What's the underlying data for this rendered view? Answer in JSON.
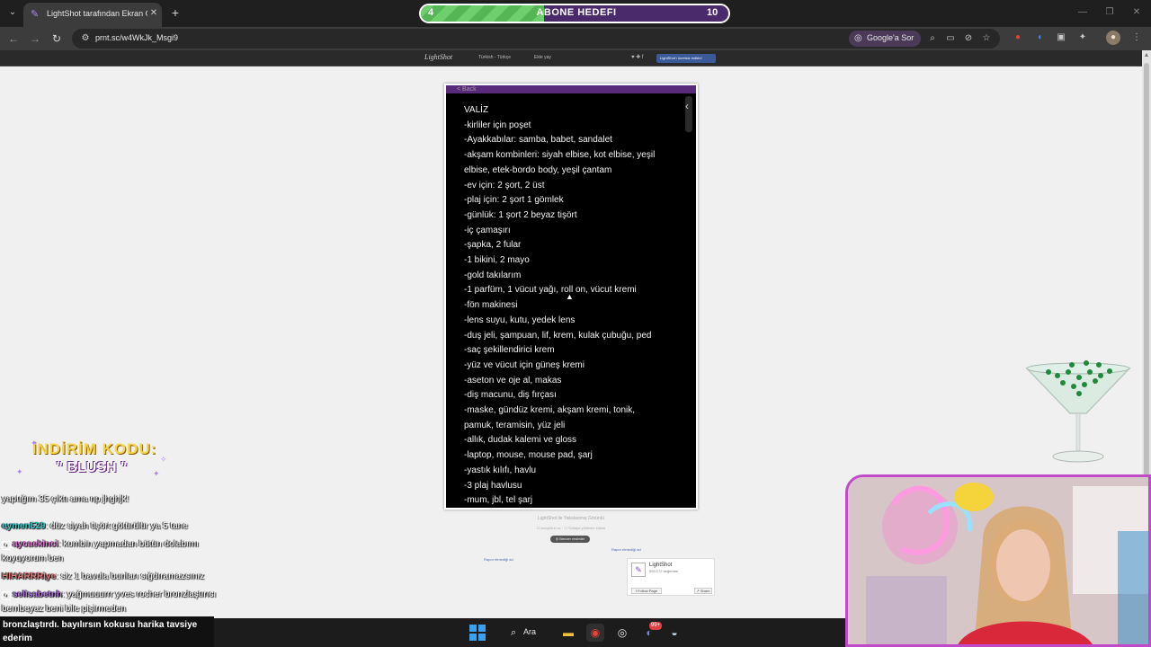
{
  "browser": {
    "tab_title": "LightShot tarafından Ekran Görü",
    "url": "prnt.sc/w4WkJk_Msgi9",
    "google_lens_label": "Google'a Sor"
  },
  "subscriber_goal": {
    "label": "ABONE HEDEFI",
    "current": "4",
    "target": "10",
    "progress": 0.4
  },
  "lightshot_header": {
    "logo": "LightShot",
    "language": "Türkish - Türkçe",
    "share": "Ekle yay",
    "social": "♥ ✚ f",
    "download": "LightShot'ı ücretsiz indirin!"
  },
  "note": {
    "back": "< Back",
    "lines": [
      "VALİZ",
      "-kirliler için poşet",
      "-Ayakkabılar: samba, babet, sandalet",
      "-akşam kombinleri: siyah elbise, kot elbise, yeşil",
      "elbise, etek-bordo body, yeşil çantam",
      "-ev için: 2 şort, 2 üst",
      "-plaj için: 2 şort 1 gömlek",
      "-günlük: 1 şort 2 beyaz tişört",
      "-iç çamaşırı",
      "-şapka, 2 fular",
      "-1 bikini, 2 mayo",
      "-gold takılarım",
      "-1 parfüm, 1 vücut yağı, roll on, vücut kremi",
      "-fön makinesi",
      "-lens suyu, kutu, yedek lens",
      "-duş jeli, şampuan, lif, krem, kulak çubuğu, ped",
      "-saç şekillendirici krem",
      "-yüz ve vücut için güneş kremi",
      "-aseton ve oje al, makas",
      "-diş macunu, diş fırçası",
      "-maske, gündüz kremi, akşam kremi, tonik,",
      "pamuk, teramisin, yüz jeli",
      "-allık, dudak kalemi ve gloss",
      "-laptop, mouse, mouse pad, şarj",
      "-yastık kılıfı, havlu",
      "-3 plaj havlusu",
      "-mum, jbl, tel şarj"
    ]
  },
  "below_screenshot": {
    "caption": "LightShot ile Yakalanmış Görüntü",
    "links": "☐ sampleurl.sc · ☐ Soltaya yükleme süresi",
    "similar_button": "◎ Benzer resimler",
    "report_left": "Rapor etmediği ad",
    "report_right": "Rapor etmediği ad"
  },
  "facebook_box": {
    "name": "LightShot",
    "followers": "590.172 beğenme",
    "follow": "f Follow Page",
    "share": "↗ Share"
  },
  "promo": {
    "label": "İNDİRİM KODU:",
    "code": "\" BLUSH \""
  },
  "chat": [
    {
      "user": "",
      "text": "yaptığım 35 çıktı ama np jhghjk!",
      "color": "#ffffff",
      "badge": ""
    },
    {
      "user": "eymen529",
      "text": ": düz siyah tişört götürülür ya 5 tane",
      "color": "#3ac7c7",
      "badge": ""
    },
    {
      "user": "aycaekinci",
      "text": ": kombin yapmadan bütün dolabımı koyuyorum ben",
      "color": "#e07ad8",
      "badge": "◐"
    },
    {
      "user": "HIHARRRiye",
      "text": ": siz 1 bavula bunları sığdıramazsınız",
      "color": "#e07a7a",
      "badge": ""
    },
    {
      "user": "selisabetnh",
      "text": ": yağmuuurrr yves rocher bronzlaştırıcı bembeyaz beni bile pişirmeden",
      "color": "#b07ae0",
      "badge": "◐"
    }
  ],
  "stream_caption": "bronzlaştırdı. bayılırsın kokusu harika tavsiye ederim",
  "taskbar": {
    "search_label": "Ara",
    "discord_badge": "99+"
  }
}
